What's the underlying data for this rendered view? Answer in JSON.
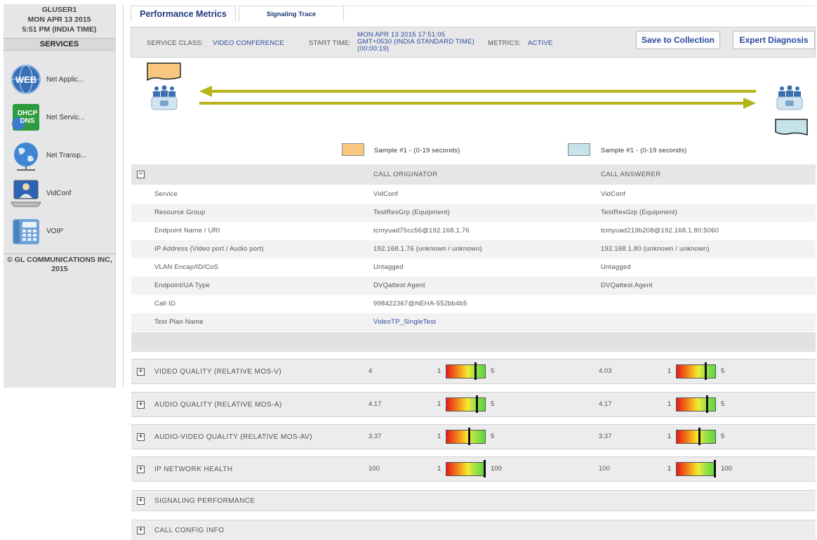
{
  "sidebar": {
    "user": "GLUSER1",
    "date": "MON APR 13 2015",
    "time": "5:51 PM (INDIA TIME)",
    "services_label": "SERVICES",
    "items": [
      {
        "label": "Net Applic...",
        "icon": "web-globe-icon"
      },
      {
        "label": "Net Servic...",
        "icon": "dhcp-dns-icon"
      },
      {
        "label": "Net Transp...",
        "icon": "network-globe-icon"
      },
      {
        "label": "VidConf",
        "icon": "video-conference-icon"
      },
      {
        "label": "VOIP",
        "icon": "ip-phone-icon"
      }
    ],
    "copyright_line1": "© GL COMMUNICATIONS INC,",
    "copyright_line2": "2015"
  },
  "tabs": [
    {
      "label": "Performance Metrics",
      "active": true
    },
    {
      "label": "Signaling Trace",
      "active": false
    }
  ],
  "infobar": {
    "service_class_label": "SERVICE CLASS:",
    "service_class_value": "VIDEO CONFERENCE",
    "start_time_label": "START TIME:",
    "start_time_line1": "MON APR 13 2015 17:51:05",
    "start_time_line2": "GMT+0530 (INDIA STANDARD TIME)",
    "start_time_line3": "(00:00:19)",
    "metrics_label": "METRICS:",
    "metrics_value": "ACTIVE",
    "save_button": "Save to Collection",
    "expert_button": "Expert Diagnosis"
  },
  "colors": {
    "originator": "#f9c77f",
    "answerer": "#c5e3e8",
    "arrow": "#b5b317",
    "link": "#2a4aa0"
  },
  "legend": {
    "originator": "Sample #1 - (0-19 seconds)",
    "answerer": "Sample #1 - (0-19 seconds)"
  },
  "call_table": {
    "collapse_symbol": "−",
    "header_originator": "CALL ORIGINATOR",
    "header_answerer": "CALL ANSWERER",
    "rows": [
      {
        "label": "Service",
        "originator": "VidConf",
        "answerer": "VidConf"
      },
      {
        "label": "Resource Group",
        "originator": "TestResGrp (Equipment)",
        "answerer": "TestResGrp (Equipment)"
      },
      {
        "label": "Endpoint Name / URI",
        "originator": "tcmyuad75cc56@192.168.1.76",
        "answerer": "tcmyuad219b208@192.168.1.80:5060"
      },
      {
        "label": "IP Address (Video port / Audio port)",
        "originator": "192.168.1.76 (unknown / unknown)",
        "answerer": "192.168.1.80 (unknown / unknown)"
      },
      {
        "label": "VLAN Encap/ID/CoS",
        "originator": "Untagged",
        "answerer": "Untagged"
      },
      {
        "label": "Endpoint/UA Type",
        "originator": "DVQattest Agent",
        "answerer": "DVQattest Agent"
      },
      {
        "label": "Call ID",
        "originator": "998422367@NEHA-552bb4b5",
        "answerer": ""
      },
      {
        "label": "Test Plan Name",
        "originator": "VideoTP_SingleTest",
        "answerer": ""
      }
    ]
  },
  "sections": [
    {
      "label": "VIDEO QUALITY (RELATIVE MOS-V)",
      "expand_symbol": "+",
      "originator_value": "4",
      "answerer_value": "4.03",
      "gauge_min": "1",
      "gauge_max": "5",
      "originator_level": 0.75,
      "answerer_level": 0.758
    },
    {
      "label": "AUDIO QUALITY (RELATIVE MOS-A)",
      "expand_symbol": "+",
      "originator_value": "4.17",
      "answerer_value": "4.17",
      "gauge_min": "1",
      "gauge_max": "5",
      "originator_level": 0.793,
      "answerer_level": 0.793
    },
    {
      "label": "AUDIO-VIDEO QUALITY (RELATIVE MOS-AV)",
      "expand_symbol": "+",
      "originator_value": "3.37",
      "answerer_value": "3.37",
      "gauge_min": "1",
      "gauge_max": "5",
      "originator_level": 0.593,
      "answerer_level": 0.593
    },
    {
      "label": "IP NETWORK HEALTH",
      "expand_symbol": "+",
      "originator_value": "100",
      "answerer_value": "100",
      "gauge_min": "1",
      "gauge_max": "100",
      "originator_level": 1.0,
      "answerer_level": 1.0
    },
    {
      "label": "SIGNALING PERFORMANCE",
      "expand_symbol": "+"
    },
    {
      "label": "CALL CONFIG INFO",
      "expand_symbol": "+"
    }
  ]
}
